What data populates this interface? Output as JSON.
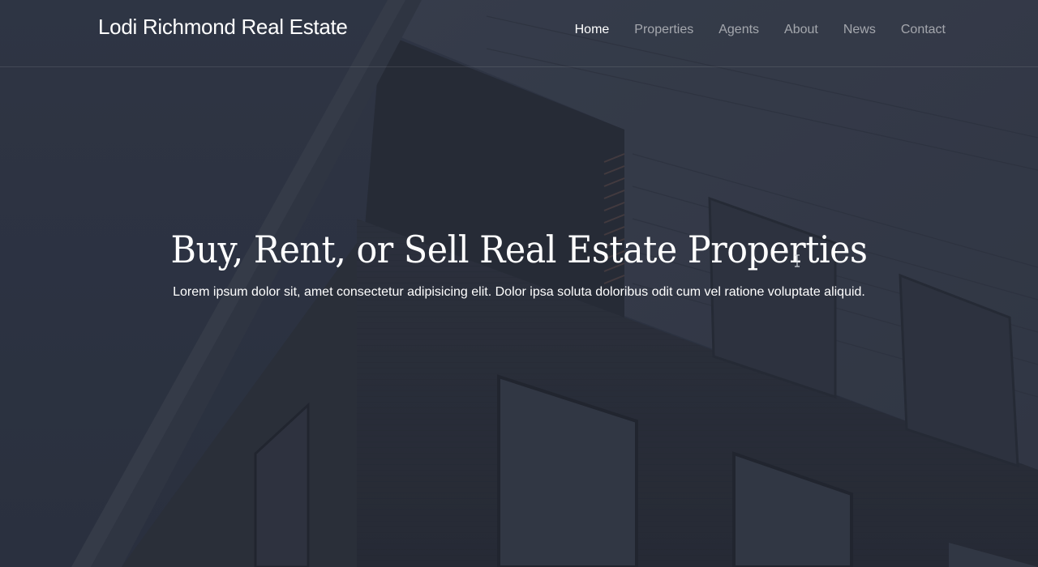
{
  "header": {
    "brand": "Lodi Richmond Real Estate",
    "nav": [
      {
        "label": "Home",
        "active": true
      },
      {
        "label": "Properties",
        "active": false
      },
      {
        "label": "Agents",
        "active": false
      },
      {
        "label": "About",
        "active": false
      },
      {
        "label": "News",
        "active": false
      },
      {
        "label": "Contact",
        "active": false
      }
    ]
  },
  "hero": {
    "title": "Buy, Rent, or Sell Real Estate Properties",
    "subtitle": "Lorem ipsum dolor sit, amet consectetur adipisicing elit. Dolor ipsa soluta doloribus odit cum vel ratione voluptate aliquid."
  },
  "colors": {
    "overlay": "#2c3342",
    "text": "#ffffff",
    "nav_inactive": "#9aa0aa"
  }
}
